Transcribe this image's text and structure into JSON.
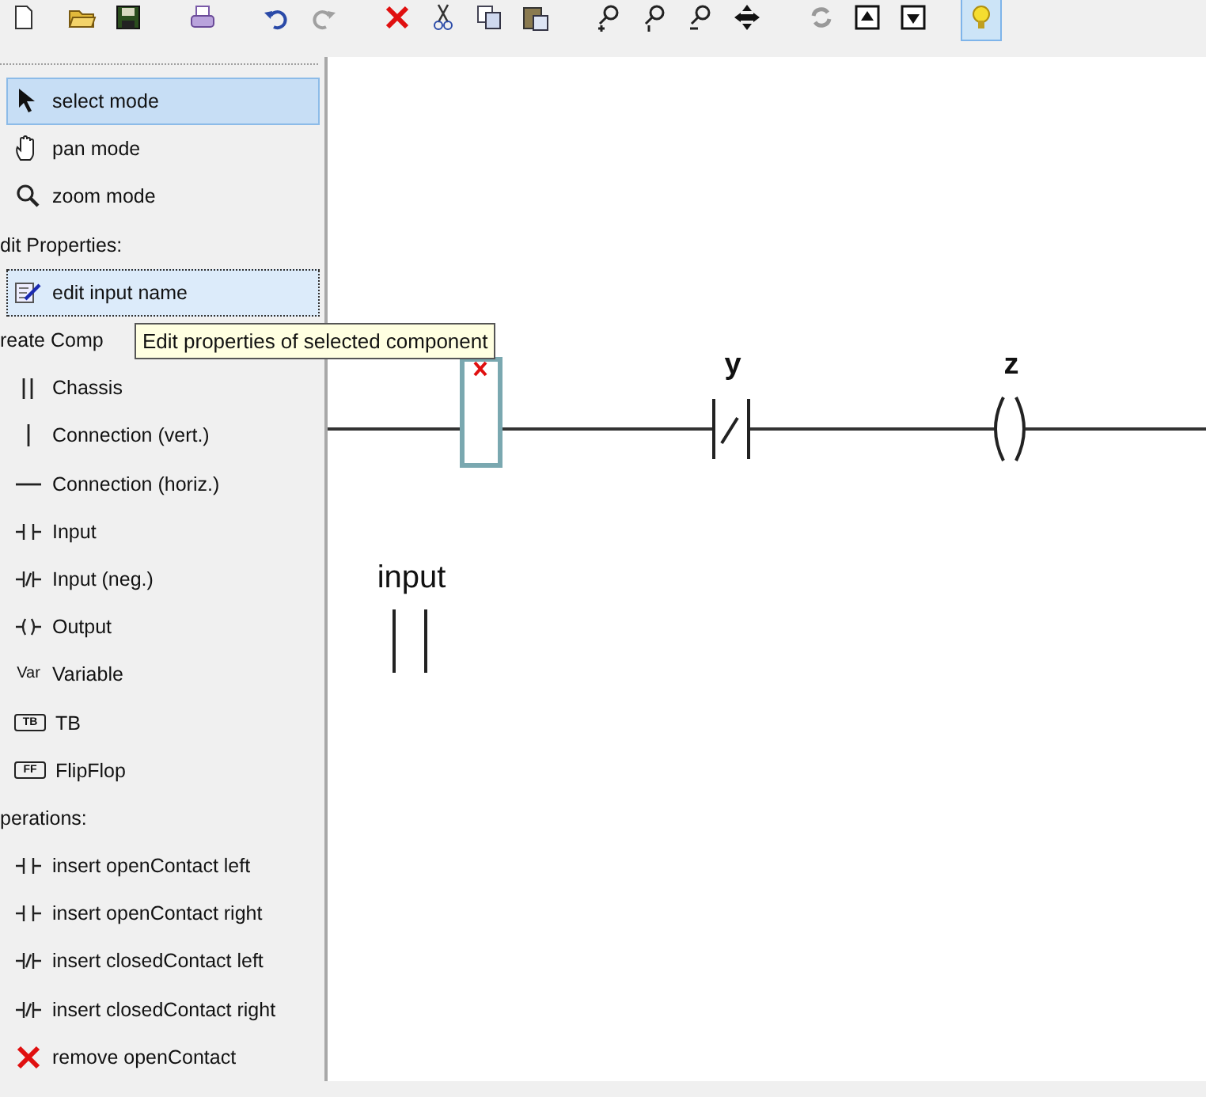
{
  "toolbar": [
    {
      "pressed": false
    },
    {
      "pressed": false
    },
    {
      "pressed": false
    },
    {
      "pressed": false
    },
    {
      "pressed": false
    },
    {
      "pressed": false
    },
    {
      "pressed": false
    },
    {
      "pressed": false
    },
    {
      "pressed": false
    },
    {
      "pressed": false
    },
    {
      "pressed": false
    },
    {
      "pressed": false
    },
    {
      "pressed": false
    },
    {
      "pressed": false
    },
    {
      "pressed": false
    },
    {
      "pressed": false
    },
    {
      "pressed": false
    },
    {
      "pressed": true
    }
  ],
  "sidebar": {
    "items": [
      {
        "kind": "tool",
        "label": "select mode",
        "selected": true,
        "focused": false
      },
      {
        "kind": "tool",
        "label": "pan mode",
        "selected": false,
        "focused": false
      },
      {
        "kind": "tool",
        "label": "zoom mode",
        "selected": false,
        "focused": false
      },
      {
        "kind": "header",
        "label": "dit Properties:"
      },
      {
        "kind": "tool",
        "label": "edit input name",
        "selected": false,
        "focused": true
      },
      {
        "kind": "header",
        "label": "reate Comp"
      },
      {
        "kind": "tool",
        "label": "Chassis",
        "selected": false,
        "focused": false
      },
      {
        "kind": "tool",
        "label": "Connection (vert.)",
        "selected": false,
        "focused": false
      },
      {
        "kind": "tool",
        "label": "Connection (horiz.)",
        "selected": false,
        "focused": false
      },
      {
        "kind": "tool",
        "label": "Input",
        "selected": false,
        "focused": false
      },
      {
        "kind": "tool",
        "label": "Input (neg.)",
        "selected": false,
        "focused": false
      },
      {
        "kind": "tool",
        "label": "Output",
        "selected": false,
        "focused": false
      },
      {
        "kind": "tool",
        "label": "Variable",
        "icon_text": "Var",
        "selected": false,
        "focused": false
      },
      {
        "kind": "tool",
        "label": "TB",
        "icon_text": "TB",
        "selected": false,
        "focused": false
      },
      {
        "kind": "tool",
        "label": "FlipFlop",
        "icon_text": "FF",
        "selected": false,
        "focused": false
      },
      {
        "kind": "header",
        "label": "perations:"
      },
      {
        "kind": "tool",
        "label": "insert openContact left",
        "selected": false,
        "focused": false
      },
      {
        "kind": "tool",
        "label": "insert openContact right",
        "selected": false,
        "focused": false
      },
      {
        "kind": "tool",
        "label": "insert closedContact left",
        "selected": false,
        "focused": false
      },
      {
        "kind": "tool",
        "label": "insert closedContact right",
        "selected": false,
        "focused": false
      },
      {
        "kind": "tool",
        "label": "remove openContact",
        "selected": false,
        "focused": false
      }
    ]
  },
  "tooltip": "Edit properties of selected component",
  "canvas": {
    "components": [
      {
        "kind": "block",
        "selected": true
      },
      {
        "kind": "closed_contact",
        "label": "y",
        "selected": false
      },
      {
        "kind": "coil",
        "label": "z",
        "selected": false
      },
      {
        "kind": "open_contact",
        "label": "input",
        "selected": false
      }
    ]
  }
}
